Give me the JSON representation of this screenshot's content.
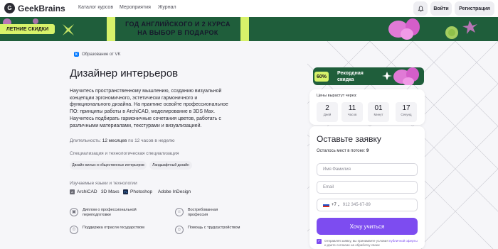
{
  "brand": {
    "logo_letter": "G",
    "name": "GeekBrains"
  },
  "nav": {
    "items": [
      "Каталог курсов",
      "Мероприятия",
      "Журнал"
    ],
    "login_label": "Войти",
    "register_label": "Регистрация",
    "bell_icon": "bell-icon"
  },
  "banner": {
    "line1": "ГОД АНГЛИЙСКОГО И 2 КУРСА",
    "line2": "НА ВЫБОР В ПОДАРОК",
    "tag": "ЛЕТНИЕ СКИДКИ",
    "bg_color": "#1f5e3b",
    "accent_color": "#d7f26a"
  },
  "course": {
    "partner_icon_letter": "К",
    "partner": "Образование от VK",
    "title": "Дизайнер интерьеров",
    "description": "Научитесь пространственному мышлению, созданию визуальной концепции эргономичного, эстетически гармоничного и функционального дизайна. На практике освойте профессиональное ПО: принципы работы в ArchiCAD, моделирование в 3DS Max. Научитесь подбирать гармоничные сочетания цветов, работать с различными материалами, текстурами и визуализацией.",
    "duration_label": "Длительность:",
    "duration_value": "12 месяцев",
    "duration_rest": "по 12 часов в неделю",
    "spec_label": "Специализация и технологическая специализация",
    "chips": [
      "Дизайн жилых и общественных интерьеров",
      "Ландшафтный дизайн"
    ],
    "lang_label": "Изучаемые языки и технологии",
    "tools": [
      {
        "name": "ArchiCAD",
        "icon": "archicad-icon",
        "color": "#6b6b75",
        "mark": "A"
      },
      {
        "name": "3D Maxs",
        "icon": "",
        "color": "",
        "mark": ""
      },
      {
        "name": "Photoshop",
        "icon": "photoshop-icon",
        "color": "#1b2a48",
        "mark": "Ps"
      },
      {
        "name": "Adobe InDesign",
        "icon": "",
        "color": "",
        "mark": ""
      }
    ],
    "features": [
      {
        "text": "Диплом о профессиональной переподготовке",
        "icon": "diploma-icon"
      },
      {
        "text": "Востребованная профессия",
        "icon": "star-icon"
      },
      {
        "text": "Поддержка отрасли государством",
        "icon": "shield-icon"
      },
      {
        "text": "Помощь с трудоустройством",
        "icon": "handshake-icon"
      }
    ]
  },
  "promo": {
    "percent": "60%",
    "line1": "Рекордная",
    "line2": "скидка"
  },
  "timer": {
    "label": "Цены вырастут через:",
    "units": [
      {
        "value": "2",
        "unit": "Дней"
      },
      {
        "value": "11",
        "unit": "Часов"
      },
      {
        "value": "01",
        "unit": "Минут"
      },
      {
        "value": "17",
        "unit": "Секунд"
      }
    ]
  },
  "form": {
    "title": "Оставьте заявку",
    "seats_label": "Осталось мест в потоке:",
    "seats_value": "9",
    "name_placeholder": "Имя Фамилия",
    "email_placeholder": "Email",
    "phone_code": "+7",
    "phone_placeholder": "912 345-67-89",
    "submit_label": "Хочу учиться",
    "agree_text": "Отправляя заявку, вы принимаете условия",
    "agree_link": "публичной оферты",
    "agree_rest": "и даете согласие на обработку своих",
    "submit_color": "#7d4cf0"
  }
}
